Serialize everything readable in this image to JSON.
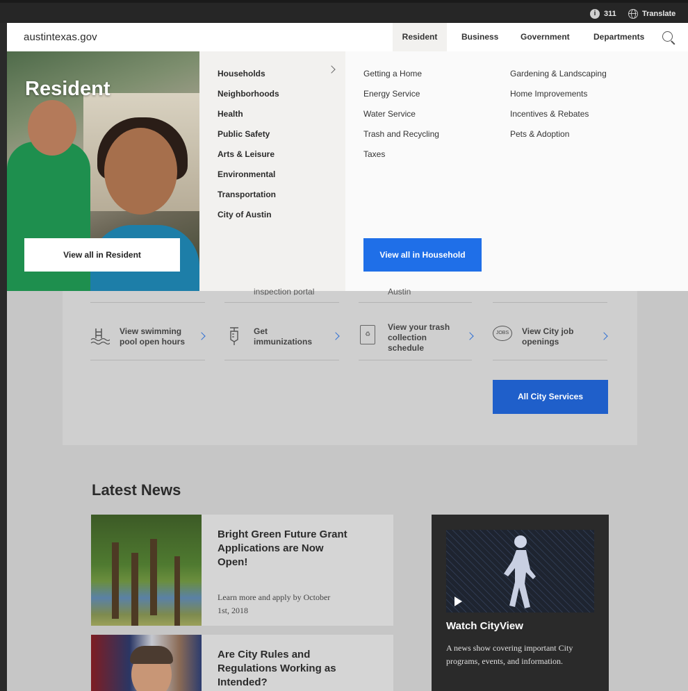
{
  "utility": {
    "info_label": "311",
    "translate_label": "Translate"
  },
  "nav": {
    "logo": "austintexas.gov",
    "items": [
      "Resident",
      "Business",
      "Government",
      "Departments"
    ],
    "active": "Resident"
  },
  "mega_menu": {
    "hero_title": "Resident",
    "view_all_label": "View all in Resident",
    "categories": [
      "Households",
      "Neighborhoods",
      "Health",
      "Public Safety",
      "Arts & Leisure",
      "Environmental",
      "Transportation",
      "City of Austin"
    ],
    "links_col1": [
      "Getting a Home",
      "Energy Service",
      "Water Service",
      "Trash and Recycling",
      "Taxes"
    ],
    "links_col2": [
      "Gardening & Landscaping",
      "Home Improvements",
      "Incentives & Rebates",
      "Pets & Adoption"
    ],
    "view_household_label": "View all in Household"
  },
  "services": {
    "partial_above": [
      "inspection portal",
      "Austin"
    ],
    "items": [
      {
        "label": "View swimming pool open hours",
        "icon": "pool-icon"
      },
      {
        "label": "Get immunizations",
        "icon": "syringe-icon"
      },
      {
        "label": "View your trash collection schedule",
        "icon": "recycle-icon"
      },
      {
        "label": "View City job openings",
        "icon": "jobs-icon"
      }
    ],
    "all_label": "All City Services"
  },
  "news": {
    "heading": "Latest News",
    "items": [
      {
        "title": "Bright Green Future Grant Applications are Now Open!",
        "desc": "Learn more and apply by October 1st, 2018"
      },
      {
        "title": "Are City Rules and Regulations Working as Intended?",
        "desc": ""
      }
    ],
    "cityview": {
      "title": "Watch CityView",
      "desc": "A news show covering important City programs, events, and information."
    }
  },
  "colors": {
    "accent_blue": "#1f6fe8",
    "button_blue": "#1f5fca",
    "dark_bar": "#262626"
  }
}
